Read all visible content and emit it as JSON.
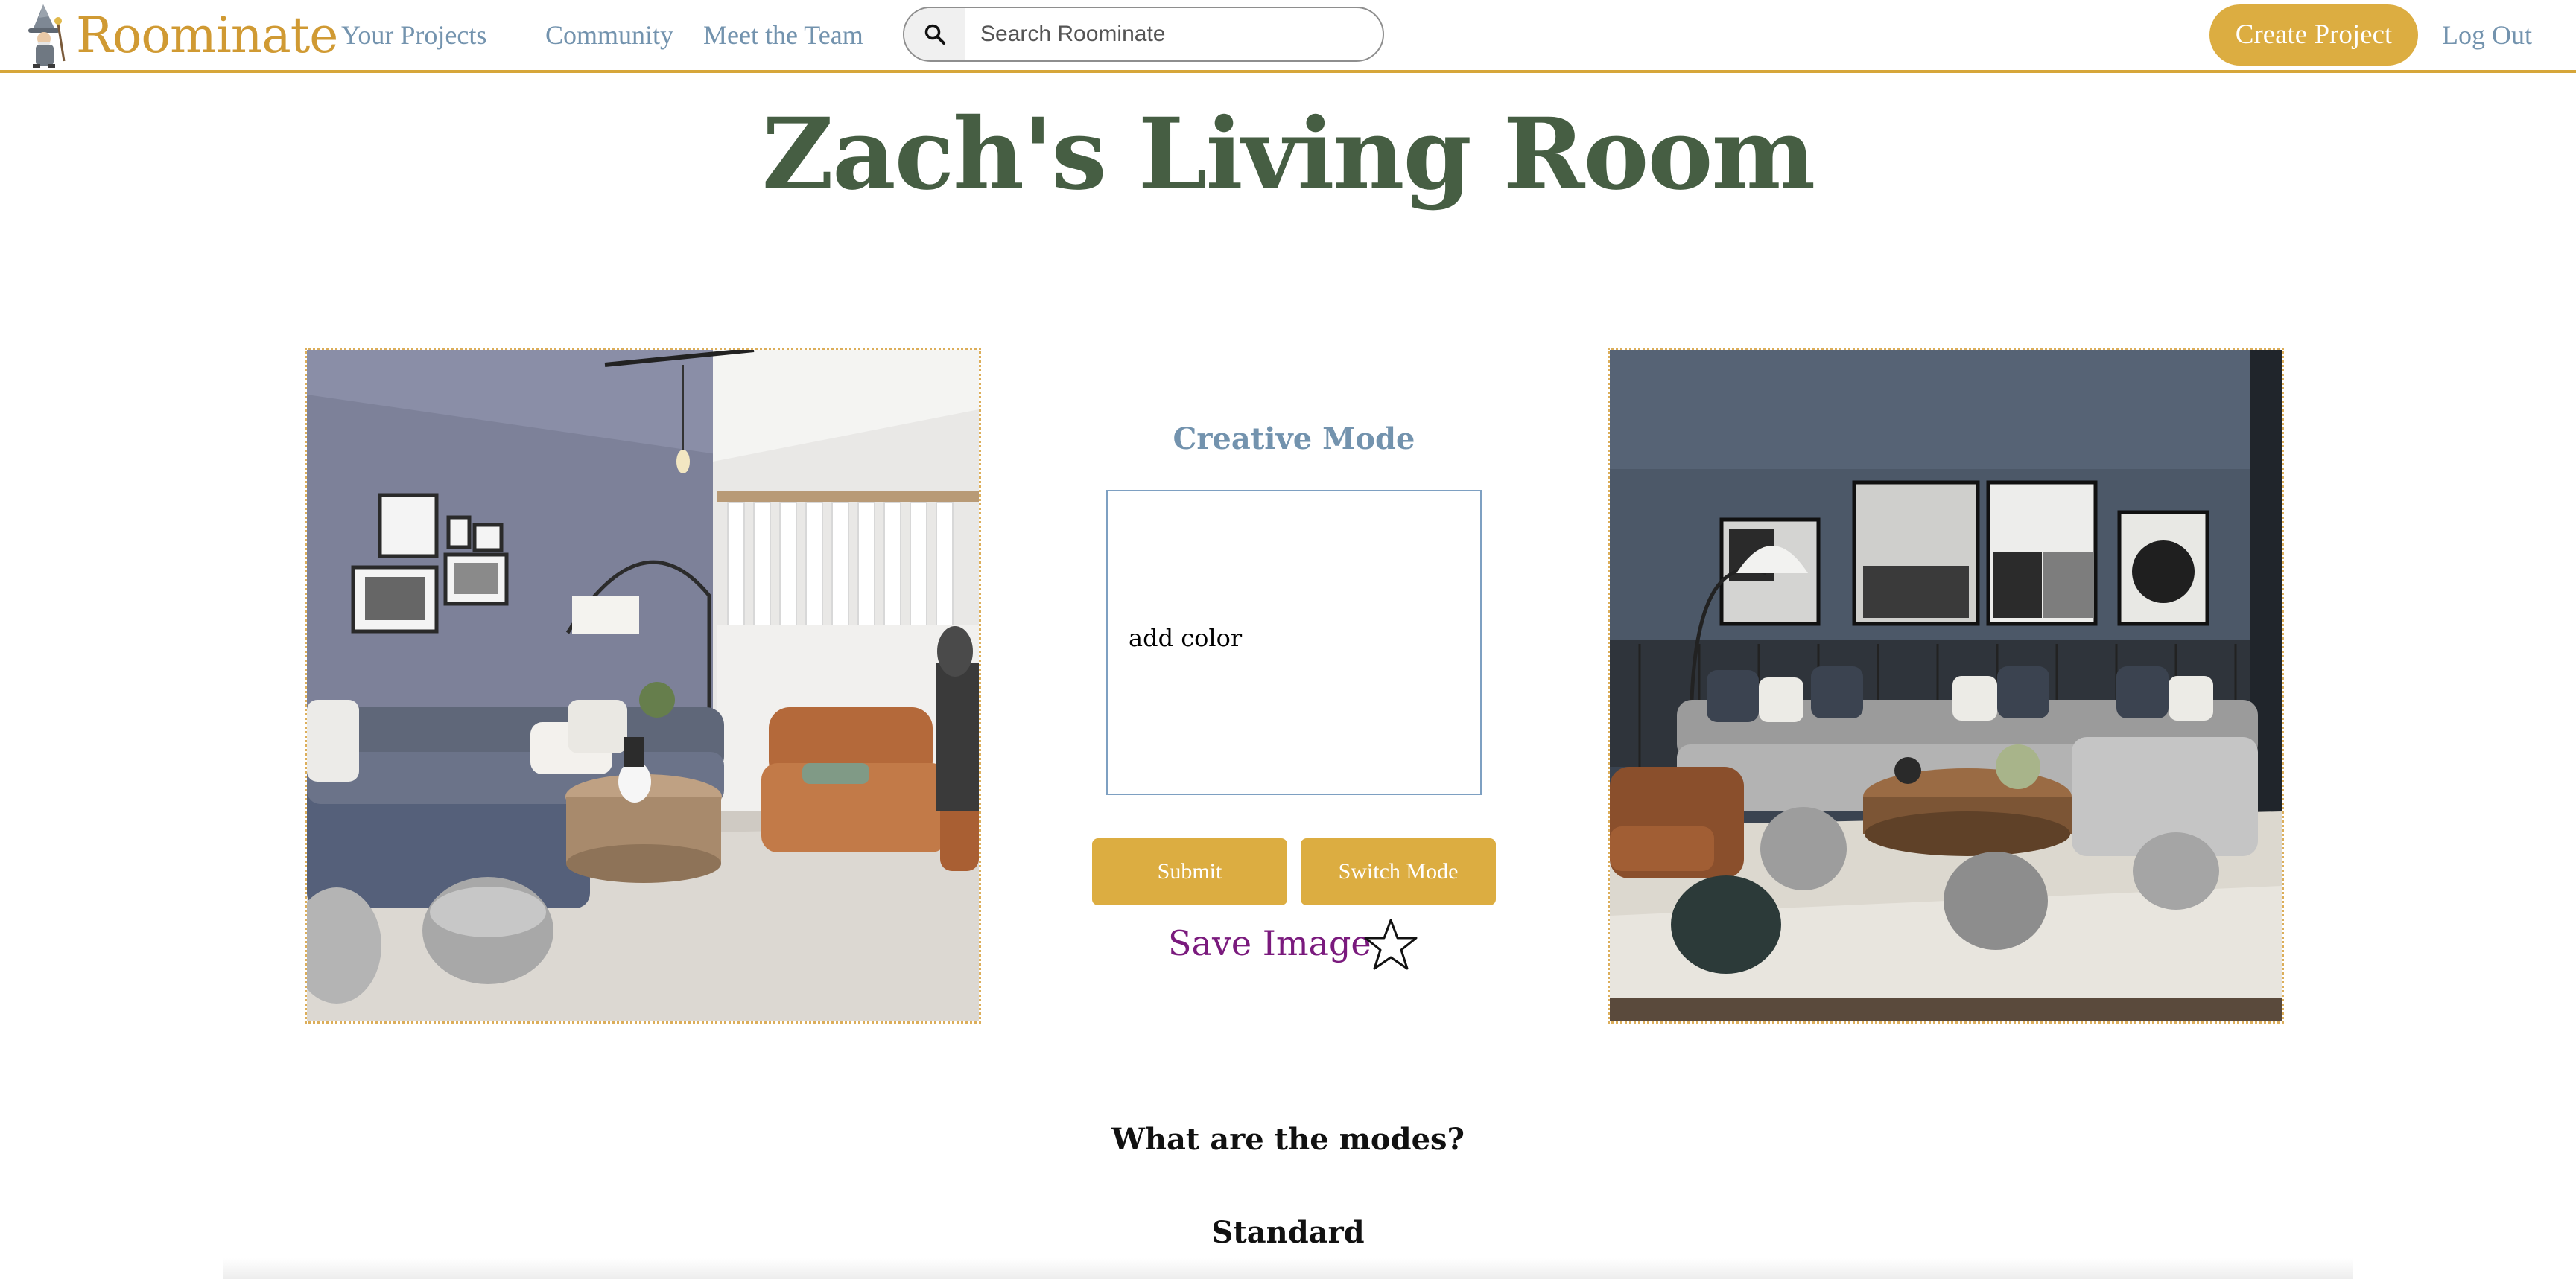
{
  "nav": {
    "brand": "Roominate",
    "links": [
      "Your Projects",
      "Community",
      "Meet the Team"
    ],
    "search_placeholder": "Search Roominate",
    "create_label": "Create Project",
    "logout_label": "Log Out",
    "accent_color": "#dcad41",
    "link_color": "#7393ae"
  },
  "page": {
    "title": "Zach's Living Room",
    "title_color": "#465e43"
  },
  "controls": {
    "mode_title": "Creative Mode",
    "prompt_text": "add color",
    "submit_label": "Submit",
    "switch_label": "Switch Mode",
    "save_label": "Save Image",
    "save_color": "#7a1a7d",
    "star_icon": "star-outline-icon"
  },
  "images": {
    "original_alt": "original living room photo",
    "generated_alt": "generated living room design"
  },
  "info": {
    "modes_heading": "What are the modes?",
    "standard_heading": "Standard"
  }
}
